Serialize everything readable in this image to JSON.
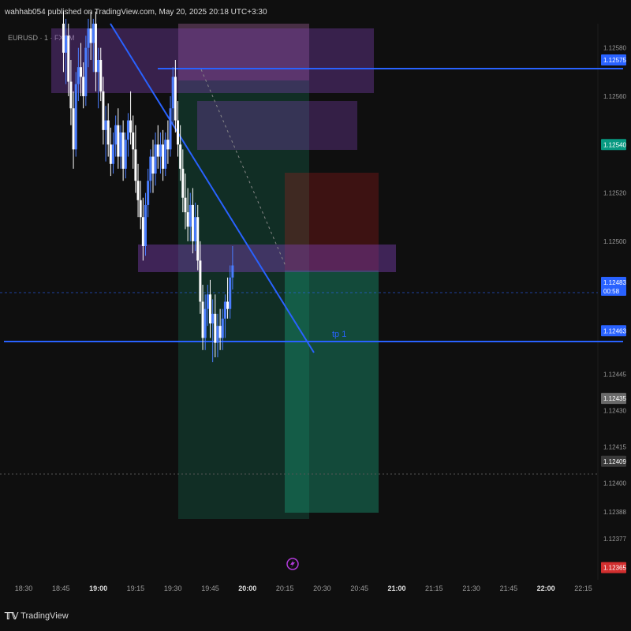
{
  "header": {
    "publisher": "wahhab054 published on TradingView.com, May 20, 2025 20:18 UTC+3:30"
  },
  "symbol": "EURUSD · 1 · FXCM",
  "footer": {
    "brand": "TradingView"
  },
  "colors": {
    "background": "#0f0f0f",
    "candle_up": "#4a7dff",
    "candle_down": "#ffffff",
    "trendline": "#2962ff",
    "zone_purple": "#7b3fb0",
    "zone_red": "#b71c1c",
    "zone_green": "#1a9e77"
  },
  "chart_data": {
    "type": "candlestick",
    "instrument": "EURUSD",
    "timeframe": "1",
    "x_ticks": [
      "18:30",
      "18:45",
      "19:00",
      "19:15",
      "19:30",
      "19:45",
      "20:00",
      "20:15",
      "20:30",
      "20:45",
      "21:00",
      "21:15",
      "21:30",
      "21:45",
      "22:00",
      "22:15"
    ],
    "y_ticks": [
      "1.12580",
      "1.12560",
      "1.12520",
      "1.12500",
      "1.12445",
      "1.12430",
      "1.12415",
      "1.12400",
      "1.12388",
      "1.12377"
    ],
    "ylim": [
      1.1236,
      1.1259
    ],
    "price_labels": [
      {
        "value": "1.12575",
        "color": "#2962ff"
      },
      {
        "value": "1.12540",
        "color": "#089981"
      },
      {
        "value": "1.12483",
        "sub": "00:58",
        "color": "#2962ff"
      },
      {
        "value": "1.12463",
        "color": "#2962ff"
      },
      {
        "value": "1.12435",
        "color": "#6a6a6a"
      },
      {
        "value": "1.12409",
        "color": "#3a3a3a"
      },
      {
        "value": "1.12365",
        "color": "#d32f2f"
      }
    ],
    "annotations": [
      {
        "text": "tp 1"
      }
    ],
    "candles": [
      {
        "t": "18:46",
        "o": 1.1259,
        "h": 1.12595,
        "l": 1.1257,
        "c": 1.12578
      },
      {
        "t": "18:47",
        "o": 1.12578,
        "h": 1.12592,
        "l": 1.12565,
        "c": 1.12585
      },
      {
        "t": "18:48",
        "o": 1.12585,
        "h": 1.1259,
        "l": 1.1256,
        "c": 1.12566
      },
      {
        "t": "18:49",
        "o": 1.12566,
        "h": 1.12575,
        "l": 1.12548,
        "c": 1.12555
      },
      {
        "t": "18:50",
        "o": 1.12555,
        "h": 1.12562,
        "l": 1.1253,
        "c": 1.12538
      },
      {
        "t": "18:51",
        "o": 1.12538,
        "h": 1.1257,
        "l": 1.12535,
        "c": 1.12565
      },
      {
        "t": "18:52",
        "o": 1.12565,
        "h": 1.1258,
        "l": 1.12558,
        "c": 1.12572
      },
      {
        "t": "18:53",
        "o": 1.12572,
        "h": 1.12582,
        "l": 1.1256,
        "c": 1.12568
      },
      {
        "t": "18:54",
        "o": 1.12568,
        "h": 1.12574,
        "l": 1.12555,
        "c": 1.1256
      },
      {
        "t": "18:55",
        "o": 1.1256,
        "h": 1.12585,
        "l": 1.12556,
        "c": 1.1258
      },
      {
        "t": "18:56",
        "o": 1.1258,
        "h": 1.12592,
        "l": 1.12572,
        "c": 1.12588
      },
      {
        "t": "18:57",
        "o": 1.12588,
        "h": 1.12595,
        "l": 1.12575,
        "c": 1.12582
      },
      {
        "t": "18:58",
        "o": 1.12582,
        "h": 1.12592,
        "l": 1.1257,
        "c": 1.1259
      },
      {
        "t": "18:59",
        "o": 1.1259,
        "h": 1.12595,
        "l": 1.12562,
        "c": 1.1257
      },
      {
        "t": "19:00",
        "o": 1.1257,
        "h": 1.1258,
        "l": 1.12555,
        "c": 1.12575
      },
      {
        "t": "19:01",
        "o": 1.12575,
        "h": 1.1258,
        "l": 1.12558,
        "c": 1.12562
      },
      {
        "t": "19:02",
        "o": 1.12562,
        "h": 1.12568,
        "l": 1.1254,
        "c": 1.12546
      },
      {
        "t": "19:03",
        "o": 1.12546,
        "h": 1.12556,
        "l": 1.12533,
        "c": 1.1255
      },
      {
        "t": "19:04",
        "o": 1.1255,
        "h": 1.12557,
        "l": 1.12535,
        "c": 1.1254
      },
      {
        "t": "19:05",
        "o": 1.1254,
        "h": 1.12547,
        "l": 1.12527,
        "c": 1.12532
      },
      {
        "t": "19:06",
        "o": 1.12532,
        "h": 1.12545,
        "l": 1.12528,
        "c": 1.1254
      },
      {
        "t": "19:07",
        "o": 1.1254,
        "h": 1.12552,
        "l": 1.12535,
        "c": 1.12548
      },
      {
        "t": "19:08",
        "o": 1.12548,
        "h": 1.12555,
        "l": 1.1253,
        "c": 1.12535
      },
      {
        "t": "19:09",
        "o": 1.12535,
        "h": 1.12548,
        "l": 1.1253,
        "c": 1.12545
      },
      {
        "t": "19:10",
        "o": 1.12545,
        "h": 1.1255,
        "l": 1.12525,
        "c": 1.1253
      },
      {
        "t": "19:11",
        "o": 1.1253,
        "h": 1.12545,
        "l": 1.12526,
        "c": 1.12542
      },
      {
        "t": "19:12",
        "o": 1.12542,
        "h": 1.12553,
        "l": 1.12535,
        "c": 1.1255
      },
      {
        "t": "19:13",
        "o": 1.1255,
        "h": 1.12562,
        "l": 1.1254,
        "c": 1.12545
      },
      {
        "t": "19:14",
        "o": 1.12545,
        "h": 1.12552,
        "l": 1.1253,
        "c": 1.12538
      },
      {
        "t": "19:15",
        "o": 1.12538,
        "h": 1.12548,
        "l": 1.1252,
        "c": 1.12525
      },
      {
        "t": "19:16",
        "o": 1.12525,
        "h": 1.12532,
        "l": 1.1251,
        "c": 1.12517
      },
      {
        "t": "19:17",
        "o": 1.12517,
        "h": 1.12525,
        "l": 1.12505,
        "c": 1.1251
      },
      {
        "t": "19:18",
        "o": 1.1251,
        "h": 1.12518,
        "l": 1.12492,
        "c": 1.12498
      },
      {
        "t": "19:19",
        "o": 1.12498,
        "h": 1.1252,
        "l": 1.12494,
        "c": 1.12515
      },
      {
        "t": "19:20",
        "o": 1.12515,
        "h": 1.1253,
        "l": 1.1251,
        "c": 1.12525
      },
      {
        "t": "19:21",
        "o": 1.12525,
        "h": 1.12538,
        "l": 1.1252,
        "c": 1.12535
      },
      {
        "t": "19:22",
        "o": 1.12535,
        "h": 1.12542,
        "l": 1.1252,
        "c": 1.12528
      },
      {
        "t": "19:23",
        "o": 1.12528,
        "h": 1.12545,
        "l": 1.12523,
        "c": 1.1254
      },
      {
        "t": "19:24",
        "o": 1.1254,
        "h": 1.12548,
        "l": 1.1253,
        "c": 1.12535
      },
      {
        "t": "19:25",
        "o": 1.12535,
        "h": 1.12545,
        "l": 1.12528,
        "c": 1.1254
      },
      {
        "t": "19:26",
        "o": 1.1254,
        "h": 1.12546,
        "l": 1.12525,
        "c": 1.1253
      },
      {
        "t": "19:27",
        "o": 1.1253,
        "h": 1.12545,
        "l": 1.12527,
        "c": 1.12542
      },
      {
        "t": "19:28",
        "o": 1.12542,
        "h": 1.1255,
        "l": 1.12532,
        "c": 1.12538
      },
      {
        "t": "19:29",
        "o": 1.12538,
        "h": 1.1256,
        "l": 1.12535,
        "c": 1.12555
      },
      {
        "t": "19:30",
        "o": 1.12555,
        "h": 1.12572,
        "l": 1.12548,
        "c": 1.12568
      },
      {
        "t": "19:31",
        "o": 1.12568,
        "h": 1.12575,
        "l": 1.12545,
        "c": 1.1255
      },
      {
        "t": "19:32",
        "o": 1.1255,
        "h": 1.12558,
        "l": 1.12535,
        "c": 1.1254
      },
      {
        "t": "19:33",
        "o": 1.1254,
        "h": 1.12548,
        "l": 1.12525,
        "c": 1.1253
      },
      {
        "t": "19:34",
        "o": 1.1253,
        "h": 1.12538,
        "l": 1.12512,
        "c": 1.12518
      },
      {
        "t": "19:35",
        "o": 1.12518,
        "h": 1.12528,
        "l": 1.12505,
        "c": 1.12512
      },
      {
        "t": "19:36",
        "o": 1.12512,
        "h": 1.12522,
        "l": 1.125,
        "c": 1.12506
      },
      {
        "t": "19:37",
        "o": 1.12506,
        "h": 1.1252,
        "l": 1.125,
        "c": 1.12515
      },
      {
        "t": "19:38",
        "o": 1.12515,
        "h": 1.12522,
        "l": 1.12495,
        "c": 1.125
      },
      {
        "t": "19:39",
        "o": 1.125,
        "h": 1.12516,
        "l": 1.12496,
        "c": 1.1251
      },
      {
        "t": "19:40",
        "o": 1.1251,
        "h": 1.12515,
        "l": 1.12488,
        "c": 1.12492
      },
      {
        "t": "19:41",
        "o": 1.12492,
        "h": 1.125,
        "l": 1.1247,
        "c": 1.12475
      },
      {
        "t": "19:42",
        "o": 1.12475,
        "h": 1.12482,
        "l": 1.12455,
        "c": 1.1246
      },
      {
        "t": "19:43",
        "o": 1.1246,
        "h": 1.12478,
        "l": 1.12455,
        "c": 1.12472
      },
      {
        "t": "19:44",
        "o": 1.12472,
        "h": 1.12482,
        "l": 1.12465,
        "c": 1.12478
      },
      {
        "t": "19:45",
        "o": 1.12478,
        "h": 1.12484,
        "l": 1.1246,
        "c": 1.12466
      },
      {
        "t": "19:46",
        "o": 1.12466,
        "h": 1.12476,
        "l": 1.1245,
        "c": 1.1247
      },
      {
        "t": "19:47",
        "o": 1.1247,
        "h": 1.12478,
        "l": 1.12452,
        "c": 1.12458
      },
      {
        "t": "19:48",
        "o": 1.12458,
        "h": 1.1247,
        "l": 1.12452,
        "c": 1.12465
      },
      {
        "t": "19:49",
        "o": 1.12465,
        "h": 1.12472,
        "l": 1.12455,
        "c": 1.1246
      },
      {
        "t": "19:50",
        "o": 1.1246,
        "h": 1.12472,
        "l": 1.12455,
        "c": 1.12468
      },
      {
        "t": "19:51",
        "o": 1.12468,
        "h": 1.12478,
        "l": 1.1246,
        "c": 1.12475
      },
      {
        "t": "19:52",
        "o": 1.12475,
        "h": 1.12485,
        "l": 1.12468,
        "c": 1.12472
      },
      {
        "t": "19:53",
        "o": 1.12472,
        "h": 1.1249,
        "l": 1.12468,
        "c": 1.12485
      },
      {
        "t": "19:54",
        "o": 1.12485,
        "h": 1.12498,
        "l": 1.1248,
        "c": 1.1249
      }
    ]
  }
}
